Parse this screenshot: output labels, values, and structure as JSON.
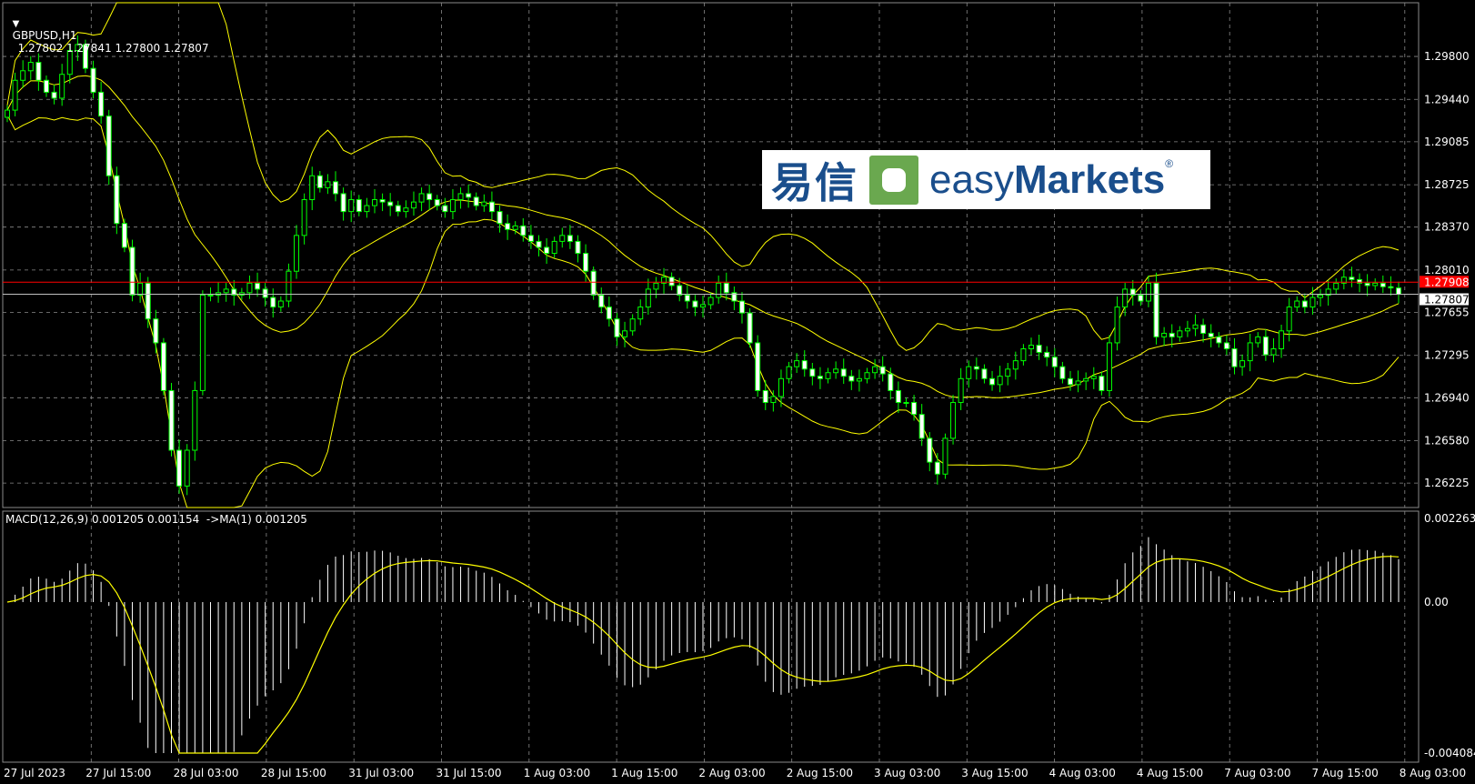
{
  "main_info": {
    "symbol": "GBPUSD,H1",
    "ohlc": "1.27802 1.27841 1.27800 1.27807"
  },
  "macd_info": {
    "label": "MACD(12,26,9) 0.001205 0.001154  ->MA(1) 0.001205"
  },
  "logo": {
    "chinese": "易信",
    "brand_light": "easy",
    "brand_bold": "Markets",
    "registered": "®"
  },
  "colors": {
    "background": "#000000",
    "grid": "#8a8a8a",
    "bull": "#00ff00",
    "bear": "#ffffff",
    "bands": "#ffff00",
    "signal": "#ffff00",
    "histogram": "#ffffff",
    "red_line": "#ff0000",
    "bid_line": "#c0c0c0",
    "logo_blue": "#1a4e8c",
    "logo_green": "#6aa84f"
  },
  "chart_data": [
    {
      "type": "candlestick",
      "title": "GBPUSD,H1",
      "ylim": [
        1.2602,
        1.3025
      ],
      "y_ticks": [
        "1.29800",
        "1.29440",
        "1.29085",
        "1.28725",
        "1.28370",
        "1.28010",
        "1.27655",
        "1.27295",
        "1.26940",
        "1.26580",
        "1.26225"
      ],
      "x_ticks": [
        "27 Jul 2023",
        "27 Jul 15:00",
        "28 Jul 03:00",
        "28 Jul 15:00",
        "31 Jul 03:00",
        "31 Jul 15:00",
        "1 Aug 03:00",
        "1 Aug 15:00",
        "2 Aug 03:00",
        "2 Aug 15:00",
        "3 Aug 03:00",
        "3 Aug 15:00",
        "4 Aug 03:00",
        "4 Aug 15:00",
        "7 Aug 03:00",
        "7 Aug 15:00",
        "8 Aug 03:00"
      ],
      "price_labels": {
        "red_level": "1.27908",
        "bid": "1.27807"
      },
      "close_series": [
        1.2935,
        1.296,
        1.2968,
        1.2975,
        1.296,
        1.295,
        1.2945,
        1.2965,
        1.2985,
        1.299,
        1.297,
        1.295,
        1.293,
        1.288,
        1.284,
        1.282,
        1.278,
        1.279,
        1.276,
        1.274,
        1.27,
        1.265,
        1.262,
        1.265,
        1.27,
        1.278,
        1.278,
        1.2782,
        1.2785,
        1.278,
        1.2782,
        1.279,
        1.2785,
        1.2778,
        1.277,
        1.2775,
        1.28,
        1.283,
        1.286,
        1.288,
        1.287,
        1.2875,
        1.2865,
        1.285,
        1.286,
        1.285,
        1.2855,
        1.286,
        1.2858,
        1.2855,
        1.285,
        1.2853,
        1.2858,
        1.2865,
        1.286,
        1.2855,
        1.285,
        1.286,
        1.2865,
        1.2862,
        1.2855,
        1.2858,
        1.285,
        1.284,
        1.2835,
        1.2838,
        1.283,
        1.2825,
        1.282,
        1.2815,
        1.2825,
        1.283,
        1.2825,
        1.2815,
        1.28,
        1.278,
        1.277,
        1.276,
        1.2745,
        1.275,
        1.276,
        1.277,
        1.2785,
        1.279,
        1.2795,
        1.2788,
        1.278,
        1.2775,
        1.277,
        1.2772,
        1.2778,
        1.279,
        1.2782,
        1.2775,
        1.2765,
        1.274,
        1.27,
        1.269,
        1.2695,
        1.271,
        1.272,
        1.2725,
        1.2718,
        1.2712,
        1.271,
        1.2715,
        1.2718,
        1.2712,
        1.2708,
        1.271,
        1.2715,
        1.272,
        1.2714,
        1.27,
        1.269,
        1.269,
        1.268,
        1.266,
        1.264,
        1.263,
        1.266,
        1.269,
        1.271,
        1.272,
        1.2718,
        1.271,
        1.2705,
        1.2712,
        1.2718,
        1.2725,
        1.2735,
        1.2738,
        1.2732,
        1.2728,
        1.272,
        1.271,
        1.2705,
        1.2708,
        1.271,
        1.2712,
        1.27,
        1.274,
        1.277,
        1.2785,
        1.278,
        1.2775,
        1.279,
        1.2745,
        1.2748,
        1.2745,
        1.275,
        1.2752,
        1.2755,
        1.2748,
        1.2745,
        1.274,
        1.2735,
        1.272,
        1.2725,
        1.274,
        1.2745,
        1.273,
        1.2735,
        1.275,
        1.277,
        1.2775,
        1.277,
        1.2778,
        1.278,
        1.2785,
        1.279,
        1.2795,
        1.2793,
        1.279,
        1.2788,
        1.279,
        1.2787,
        1.2786,
        1.27807
      ]
    },
    {
      "type": "macd",
      "title": "MACD(12,26,9)",
      "ylim": [
        -0.004084,
        0.002263
      ],
      "y_ticks": [
        "0.002263",
        "0.00",
        "-0.004084"
      ],
      "series_note": "histogram = MACD main; yellow line = signal"
    }
  ]
}
